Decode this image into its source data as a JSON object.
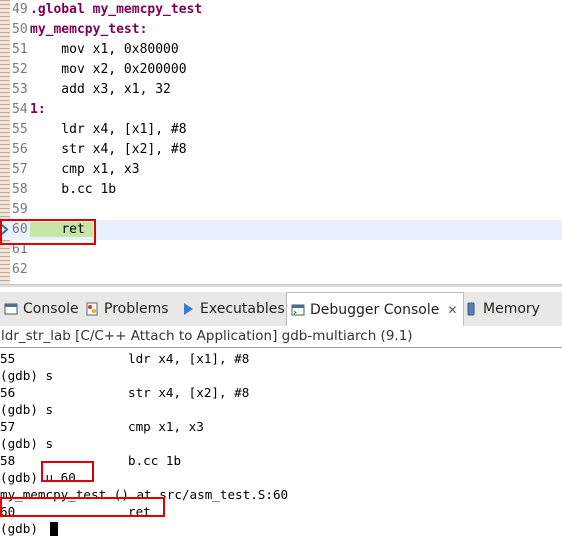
{
  "editor": {
    "lines": [
      {
        "num": "49",
        "code": ".global my_memcpy_test",
        "style": "kw"
      },
      {
        "num": "50",
        "code": "my_memcpy_test:",
        "style": "kw"
      },
      {
        "num": "51",
        "code": "    mov x1, 0x80000",
        "style": ""
      },
      {
        "num": "52",
        "code": "    mov x2, 0x200000",
        "style": ""
      },
      {
        "num": "53",
        "code": "    add x3, x1, 32",
        "style": ""
      },
      {
        "num": "54",
        "code": "1:",
        "style": "kw"
      },
      {
        "num": "55",
        "code": "    ldr x4, [x1], #8",
        "style": ""
      },
      {
        "num": "56",
        "code": "    str x4, [x2], #8",
        "style": ""
      },
      {
        "num": "57",
        "code": "    cmp x1, x3",
        "style": ""
      },
      {
        "num": "58",
        "code": "    b.cc 1b",
        "style": ""
      },
      {
        "num": "59",
        "code": "",
        "style": ""
      },
      {
        "num": "60",
        "code": "ret",
        "style": "current"
      },
      {
        "num": "61",
        "code": "",
        "style": ""
      },
      {
        "num": "62",
        "code": "",
        "style": ""
      }
    ]
  },
  "tabs": [
    {
      "label": "Console",
      "icon": "console-icon"
    },
    {
      "label": "Problems",
      "icon": "problems-icon"
    },
    {
      "label": "Executables",
      "icon": "executables-icon"
    },
    {
      "label": "Debugger Console",
      "icon": "debugger-console-icon",
      "active": true,
      "close": "✕"
    },
    {
      "label": "Memory",
      "icon": "memory-icon"
    }
  ],
  "console": {
    "launch_title": "ldr_str_lab [C/C++ Attach to Application] gdb-multiarch (9.1)",
    "lines": [
      {
        "c1": "55",
        "c2": "ldr x4, [x1], #8"
      },
      {
        "c1": "(gdb) s",
        "c2": ""
      },
      {
        "c1": "56",
        "c2": "str x4, [x2], #8"
      },
      {
        "c1": "(gdb) s",
        "c2": ""
      },
      {
        "c1": "57",
        "c2": "cmp x1, x3"
      },
      {
        "c1": "(gdb) s",
        "c2": ""
      },
      {
        "c1": "58",
        "c2": "b.cc 1b"
      },
      {
        "c1": "(gdb) u 60",
        "c2": ""
      },
      {
        "c1": "my_memcpy_test () at src/asm_test.S:60",
        "c2": ""
      },
      {
        "c1": "60",
        "c2": "ret"
      },
      {
        "c1": "(gdb)",
        "c2": ""
      }
    ]
  },
  "colors": {
    "highlight_box": "#e00000",
    "current_line": "#e8f2fe",
    "keyword": "#7f0055"
  }
}
